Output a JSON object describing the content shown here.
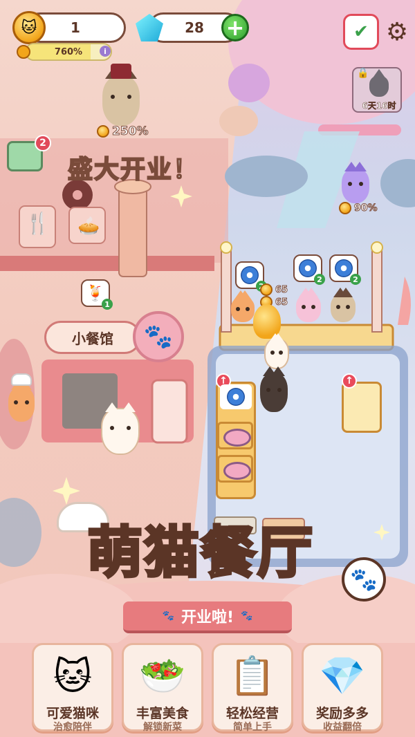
{
  "hud": {
    "coins": "1",
    "gems": "28",
    "progress_label": "760%",
    "progress_value": 0.76
  },
  "left_scene": {
    "host_bonus": "250%",
    "grand_opening": "盛大开业！",
    "lunchbox_badge": "2",
    "drink_badge": "1",
    "sign": "小餐馆"
  },
  "right_scene": {
    "locked_timer": "6天16时",
    "purple_cat_bonus": "90%",
    "order_bubbles": [
      {
        "count": "2"
      },
      {
        "count": "2"
      },
      {
        "count": "2"
      }
    ],
    "floating_coins": [
      "65",
      "65"
    ]
  },
  "title": {
    "main": "萌猫餐厅",
    "ribbon": "开业啦!"
  },
  "features": [
    {
      "title": "可爱猫咪",
      "sub": "治愈陪伴",
      "icon": "cat-icon"
    },
    {
      "title": "丰富美食",
      "sub": "解锁新菜",
      "icon": "food-icon"
    },
    {
      "title": "轻松经营",
      "sub": "简单上手",
      "icon": "checklist-icon"
    },
    {
      "title": "奖励多多",
      "sub": "收益翻倍",
      "icon": "diamond-coin-icon"
    }
  ],
  "colors": {
    "brand_brown": "#5b3526",
    "title_fill": "#fff2d6",
    "ribbon": "#e77b7e",
    "counter": "#f7c96d"
  }
}
